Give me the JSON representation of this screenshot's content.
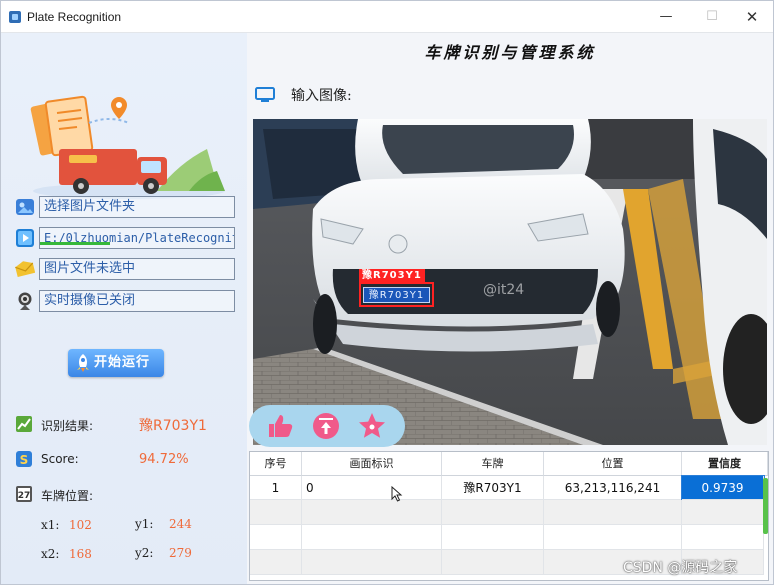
{
  "window": {
    "title": "Plate Recognition",
    "min_glyph": "—",
    "max_glyph": "☐",
    "close_glyph": "✕"
  },
  "left": {
    "folder_field": "选择图片文件夹",
    "path_field": "E:/0lzhuomian/PlateRecogniti",
    "file_field": "图片文件未选中",
    "camera_field": "实时摄像已关闭",
    "progress_fraction": 0.36,
    "run_button": "开始运行",
    "result_label": "识别结果:",
    "result_value": "豫R703Y1",
    "score_label": "Score:",
    "score_value": "94.72%",
    "position_label": "车牌位置:",
    "x1_label": "x1:",
    "x1_value": "102",
    "y1_label": "y1:",
    "y1_value": "244",
    "x2_label": "x2:",
    "x2_value": "168",
    "y2_label": "y2:",
    "y2_value": "279"
  },
  "right": {
    "main_title": "车牌识别与管理系统",
    "input_label": "输入图像:",
    "detection_tag": "豫R703Y1",
    "plate_text": "豫R703Y1"
  },
  "table": {
    "columns": [
      "序号",
      "画面标识",
      "车牌",
      "位置",
      "置信度"
    ],
    "rows": [
      [
        "1",
        "0",
        "豫R703Y1",
        "63,213,116,241",
        "0.9739"
      ]
    ]
  },
  "watermark": "CSDN @源码之家",
  "colors": {
    "accent": "#3a86e6",
    "value_orange": "#ef6a3a",
    "selected_cell": "#0a6fd6",
    "detection_red": "#ff2222",
    "action_bar": "#a9d6ee",
    "action_icon": "#f05a8a"
  },
  "icons": {
    "folder": "image-folder-icon",
    "video": "video-play-icon",
    "file": "envelope-icon",
    "camera": "webcam-icon",
    "monitor": "monitor-icon",
    "like": "thumbs-up-icon",
    "top": "back-to-top-icon",
    "star": "star-icon"
  }
}
